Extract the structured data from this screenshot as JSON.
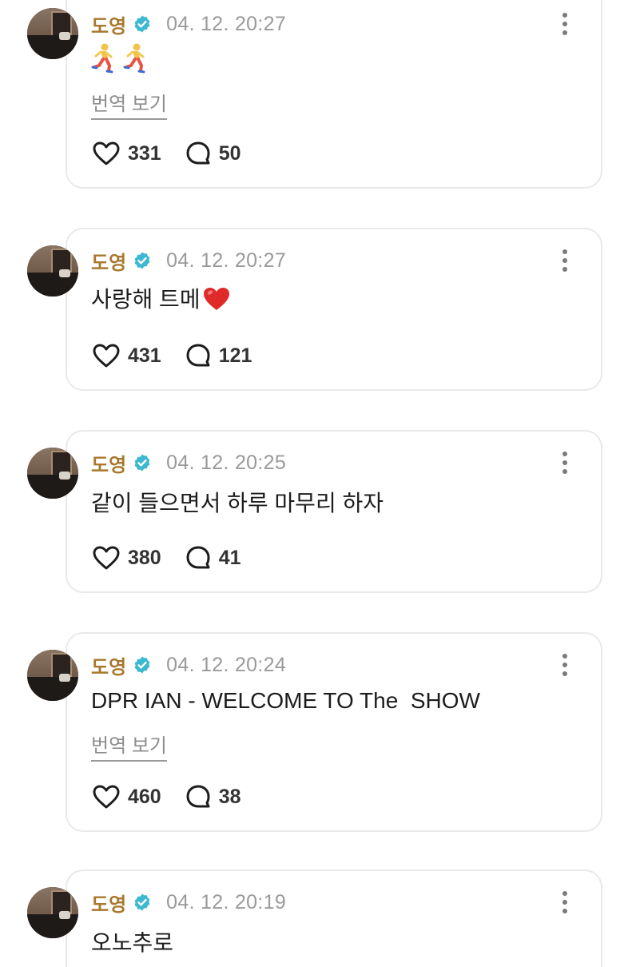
{
  "posts": [
    {
      "author": "도영",
      "time": "04. 12. 20:27",
      "text": "",
      "emojis": [
        "runner-emoji",
        "runner-emoji"
      ],
      "translate_label": "번역 보기",
      "likes": "331",
      "comments": "50"
    },
    {
      "author": "도영",
      "time": "04. 12. 20:27",
      "text": "사랑해 트메",
      "emojis": [
        "red-heart-emoji"
      ],
      "likes": "431",
      "comments": "121"
    },
    {
      "author": "도영",
      "time": "04. 12. 20:25",
      "text": "같이 들으면서 하루 마무리 하자",
      "likes": "380",
      "comments": "41"
    },
    {
      "author": "도영",
      "time": "04. 12. 20:24",
      "text": "DPR IAN - WELCOME TO The  SHOW",
      "translate_label": "번역 보기",
      "likes": "460",
      "comments": "38"
    },
    {
      "author": "도영",
      "time": "04. 12. 20:19",
      "text": "오노추로"
    }
  ],
  "colors": {
    "author": "#a9782f",
    "verified_badge": "#3cb8d1",
    "timestamp": "#9a9a9a",
    "card_border": "#e9e9e9",
    "heart_emoji": "#e02a2a"
  },
  "icons": {
    "like": "heart-outline-icon",
    "comment": "speech-bubble-icon",
    "more": "vertical-ellipsis-icon",
    "verified": "verified-badge-icon"
  }
}
